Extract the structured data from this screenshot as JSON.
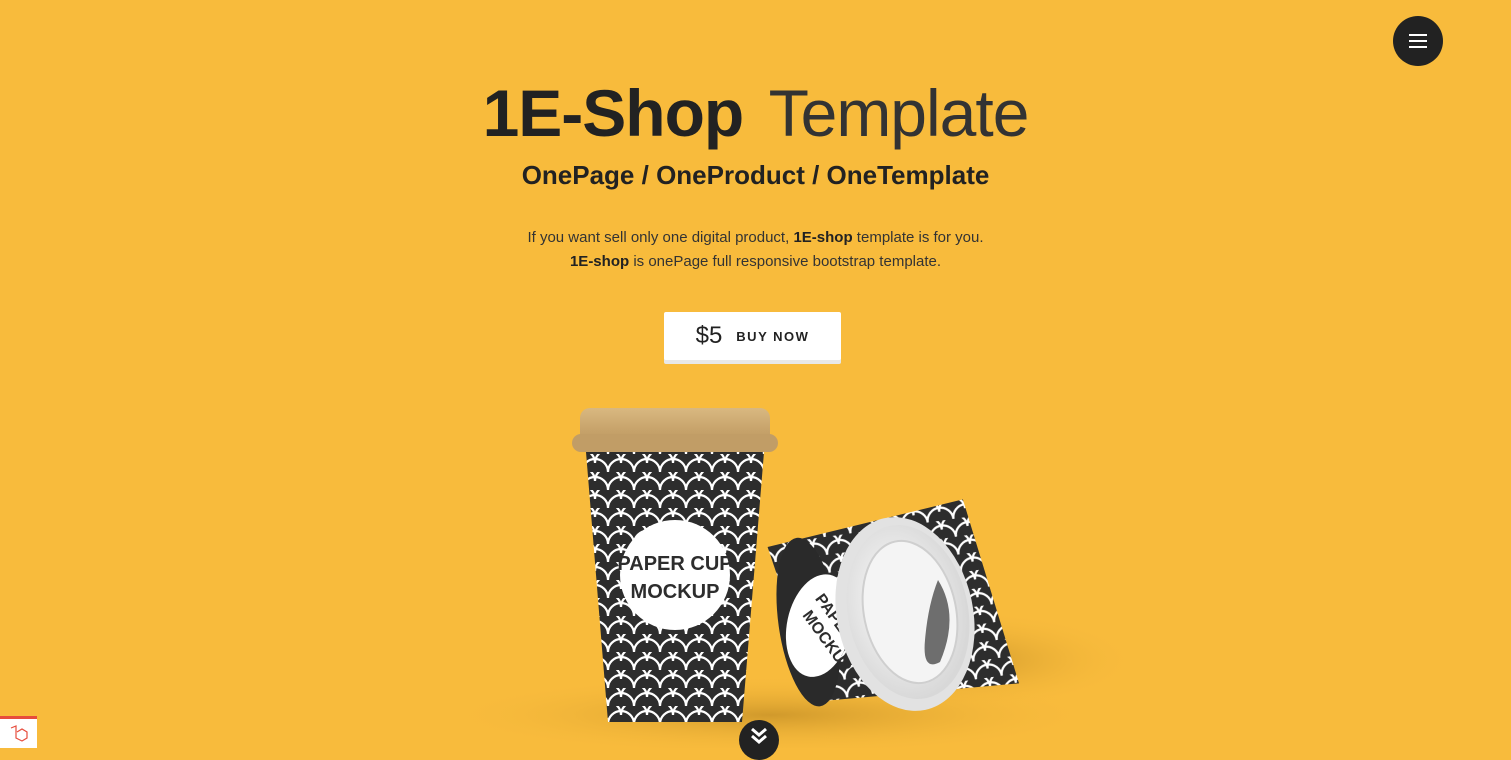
{
  "header": {
    "title_strong": "1E-Shop",
    "title_light": "Template",
    "subtitle": "OnePage / OneProduct / OneTemplate"
  },
  "description": {
    "line1_before": "If you want sell only one digital product, ",
    "line1_bold": "1E-shop",
    "line1_after": " template is for you.",
    "line2_bold": "1E-shop",
    "line2_after": " is onePage full responsive bootstrap template."
  },
  "buy": {
    "price": "$5",
    "label": "BUY NOW"
  },
  "product": {
    "cup_text_line1": "PAPER CUP",
    "cup_text_line2": "MOCKUP",
    "lying_cup_text_line1": "PAPER CUP",
    "lying_cup_text_line2": "MOCKUP"
  },
  "colors": {
    "background": "#F8BB3C",
    "dark": "#222222",
    "lid": "#C9A56E"
  },
  "icons": {
    "menu": "hamburger-icon",
    "scroll": "double-chevron-down-icon",
    "badge": "laravel-logo-icon"
  }
}
